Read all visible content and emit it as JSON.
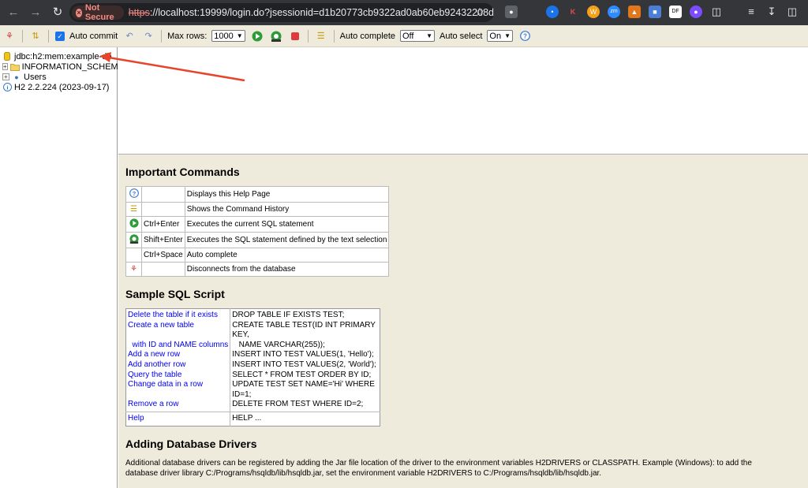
{
  "browser": {
    "security_label": "Not Secure",
    "url_scheme": "https",
    "url_rest": "://localhost:19999/login.do?jsessionid=d1b20773cb9322ad0ab60eb92432208d"
  },
  "toolbar": {
    "auto_commit_label": "Auto commit",
    "max_rows_label": "Max rows:",
    "max_rows_value": "1000",
    "auto_complete_label": "Auto complete",
    "auto_complete_value": "Off",
    "auto_select_label": "Auto select",
    "auto_select_value": "On"
  },
  "tree": {
    "items": [
      {
        "label": "jdbc:h2:mem:example-db"
      },
      {
        "label": "INFORMATION_SCHEMA"
      },
      {
        "label": "Users"
      },
      {
        "label": "H2 2.2.224 (2023-09-17)"
      }
    ]
  },
  "help": {
    "important_title": "Important Commands",
    "commands": [
      {
        "keys": "",
        "desc": "Displays this Help Page"
      },
      {
        "keys": "",
        "desc": "Shows the Command History"
      },
      {
        "keys": "Ctrl+Enter",
        "desc": "Executes the current SQL statement"
      },
      {
        "keys": "Shift+Enter",
        "desc": "Executes the SQL statement defined by the text selection"
      },
      {
        "keys": "Ctrl+Space",
        "desc": "Auto complete"
      },
      {
        "keys": "",
        "desc": "Disconnects from the database"
      }
    ],
    "sample_title": "Sample SQL Script",
    "sample": {
      "drop_desc": "Delete the table if it exists",
      "drop_sql": "DROP TABLE IF EXISTS TEST;",
      "create_desc": "Create a new table",
      "create_sql": "CREATE TABLE TEST(ID INT PRIMARY KEY,",
      "create_desc2": "  with ID and NAME columns",
      "create_sql2": "   NAME VARCHAR(255));",
      "add_desc": "Add a new row",
      "add_sql": "INSERT INTO TEST VALUES(1, 'Hello');",
      "add2_desc": "Add another row",
      "add2_sql": "INSERT INTO TEST VALUES(2, 'World');",
      "query_desc": "Query the table",
      "query_sql": "SELECT * FROM TEST ORDER BY ID;",
      "change_desc": "Change data in a row",
      "change_sql": "UPDATE TEST SET NAME='Hi' WHERE ID=1;",
      "remove_desc": "Remove a row",
      "remove_sql": "DELETE FROM TEST WHERE ID=2;",
      "help_desc": "Help",
      "help_sql": "HELP ..."
    },
    "drivers_title": "Adding Database Drivers",
    "drivers_text": "Additional database drivers can be registered by adding the Jar file location of the driver to the environment variables H2DRIVERS or CLASSPATH. Example (Windows): to add the database driver library C:/Programs/hsqldb/lib/hsqldb.jar, set the environment variable H2DRIVERS to C:/Programs/hsqldb/lib/hsqldb.jar."
  }
}
